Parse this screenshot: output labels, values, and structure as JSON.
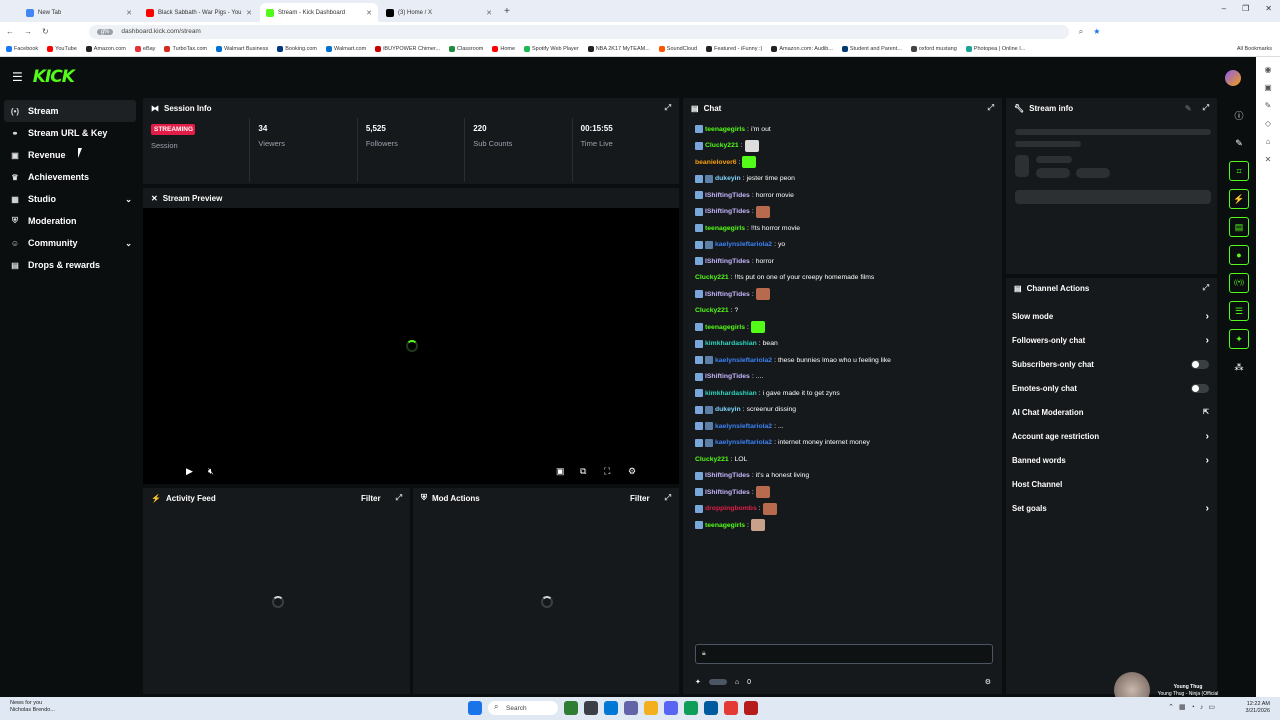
{
  "browser": {
    "tabs": [
      {
        "title": "New Tab",
        "color": "#4285f4",
        "active": false
      },
      {
        "title": "Black Sabbath - War Pigs - You",
        "color": "#ff0000",
        "active": false
      },
      {
        "title": "Stream - Kick Dashboard",
        "color": "#53fc18",
        "active": true
      },
      {
        "title": "(3) Home / X",
        "color": "#000000",
        "active": false
      }
    ],
    "new_tab": "+",
    "url": "dashboard.kick.com/stream",
    "url_chip": "g%",
    "window_controls": [
      "–",
      "❐",
      "✕"
    ],
    "bookmarks": [
      {
        "label": "Facebook",
        "color": "#1877f2"
      },
      {
        "label": "YouTube",
        "color": "#ff0000"
      },
      {
        "label": "Amazon.com",
        "color": "#222222"
      },
      {
        "label": "eBay",
        "color": "#e53238"
      },
      {
        "label": "TurboTax.com",
        "color": "#d52b1e"
      },
      {
        "label": "Walmart Business",
        "color": "#0071ce"
      },
      {
        "label": "Booking.com",
        "color": "#003580"
      },
      {
        "label": "Walmart.com",
        "color": "#0071ce"
      },
      {
        "label": "iBUYPOWER Chimer...",
        "color": "#cc0000"
      },
      {
        "label": "Classroom",
        "color": "#1e8e3e"
      },
      {
        "label": "Home",
        "color": "#ff0000"
      },
      {
        "label": "Spotify Web Player",
        "color": "#1db954"
      },
      {
        "label": "NBA 2K17 MyTEAM...",
        "color": "#222222"
      },
      {
        "label": "SoundCloud",
        "color": "#ff5500"
      },
      {
        "label": "Featured - iFunny :)",
        "color": "#222222"
      },
      {
        "label": "Amazon.com: Audib...",
        "color": "#222222"
      },
      {
        "label": "Student and Parent...",
        "color": "#003a70"
      },
      {
        "label": "oxford mustang",
        "color": "#444444"
      },
      {
        "label": "Photopea | Online I...",
        "color": "#18a497"
      }
    ],
    "all_bookmarks": "All Bookmarks"
  },
  "app": {
    "logo": "KICK",
    "nav": [
      {
        "label": "Stream",
        "icon": "broadcast-icon",
        "glyph": "(•)",
        "active": true,
        "chevron": false
      },
      {
        "label": "Stream URL & Key",
        "icon": "link-icon",
        "glyph": "⚭",
        "active": false,
        "chevron": false
      },
      {
        "label": "Revenue",
        "icon": "wallet-icon",
        "glyph": "▣",
        "active": false,
        "chevron": false
      },
      {
        "label": "Achievements",
        "icon": "trophy-icon",
        "glyph": "♛",
        "active": false,
        "chevron": false
      },
      {
        "label": "Studio",
        "icon": "studio-icon",
        "glyph": "▦",
        "active": false,
        "chevron": true
      },
      {
        "label": "Moderation",
        "icon": "shield-icon",
        "glyph": "⛨",
        "active": false,
        "chevron": false
      },
      {
        "label": "Community",
        "icon": "community-icon",
        "glyph": "☺",
        "active": false,
        "chevron": true
      },
      {
        "label": "Drops & rewards",
        "icon": "gift-icon",
        "glyph": "▤",
        "active": false,
        "chevron": false
      }
    ]
  },
  "session": {
    "title": "Session Info",
    "badge": "STREAMING",
    "badge_sub": "Session",
    "stats": [
      {
        "value": "34",
        "label": "Viewers"
      },
      {
        "value": "5,525",
        "label": "Followers"
      },
      {
        "value": "220",
        "label": "Sub Counts"
      },
      {
        "value": "00:15:55",
        "label": "Time Live"
      }
    ]
  },
  "preview": {
    "title": "Stream Preview"
  },
  "activity": {
    "title": "Activity Feed",
    "filter": "Filter"
  },
  "modactions": {
    "title": "Mod Actions",
    "filter": "Filter"
  },
  "chat": {
    "title": "Chat",
    "messages": [
      {
        "user": "teenagegirls",
        "color": "#53fc18",
        "text": "i'm out",
        "badges": 1,
        "emote": ""
      },
      {
        "user": "Clucky221",
        "color": "#53fc18",
        "text": "",
        "badges": 1,
        "emote": "#dddddd"
      },
      {
        "user": "beanielover6",
        "color": "#f59e0b",
        "text": "",
        "badges": 0,
        "emote": "#53fc18"
      },
      {
        "user": "dukeyin",
        "color": "#7dd3fc",
        "text": "jester time peon",
        "badges": 2,
        "emote": ""
      },
      {
        "user": "IShiftingTides",
        "color": "#c4b5fd",
        "text": "horror movie",
        "badges": 1,
        "emote": ""
      },
      {
        "user": "IShiftingTides",
        "color": "#c4b5fd",
        "text": "",
        "badges": 1,
        "emote": "#b86a4e"
      },
      {
        "user": "teenagegirls",
        "color": "#53fc18",
        "text": "!!ts horror movie",
        "badges": 1,
        "emote": ""
      },
      {
        "user": "kaelynsleftariola2",
        "color": "#3b82f6",
        "text": "yo",
        "badges": 2,
        "emote": ""
      },
      {
        "user": "IShiftingTides",
        "color": "#c4b5fd",
        "text": "horror",
        "badges": 1,
        "emote": ""
      },
      {
        "user": "Clucky221",
        "color": "#53fc18",
        "text": "!!ts put on one of your creepy homemade films",
        "badges": 0,
        "emote": ""
      },
      {
        "user": "IShiftingTides",
        "color": "#c4b5fd",
        "text": "",
        "badges": 1,
        "emote": "#b86a4e"
      },
      {
        "user": "Clucky221",
        "color": "#53fc18",
        "text": "?",
        "badges": 0,
        "emote": ""
      },
      {
        "user": "teenagegirls",
        "color": "#53fc18",
        "text": "",
        "badges": 1,
        "emote": "#53fc18"
      },
      {
        "user": "kimkhardashian",
        "color": "#2dd4bf",
        "text": "bean",
        "badges": 1,
        "emote": ""
      },
      {
        "user": "kaelynsleftariola2",
        "color": "#3b82f6",
        "text": "these bunnies lmao who u feeling like",
        "badges": 2,
        "emote": ""
      },
      {
        "user": "IShiftingTides",
        "color": "#c4b5fd",
        "text": "....",
        "badges": 1,
        "emote": ""
      },
      {
        "user": "kimkhardashian",
        "color": "#2dd4bf",
        "text": "i gave made it to get zyns",
        "badges": 1,
        "emote": ""
      },
      {
        "user": "dukeyin",
        "color": "#7dd3fc",
        "text": "screenur dissing",
        "badges": 2,
        "emote": ""
      },
      {
        "user": "kaelynsleftariola2",
        "color": "#3b82f6",
        "text": "...",
        "badges": 2,
        "emote": ""
      },
      {
        "user": "kaelynsleftariola2",
        "color": "#3b82f6",
        "text": "internet money internet money",
        "badges": 2,
        "emote": ""
      },
      {
        "user": "Clucky221",
        "color": "#53fc18",
        "text": "LOL",
        "badges": 0,
        "emote": ""
      },
      {
        "user": "IShiftingTides",
        "color": "#c4b5fd",
        "text": "it's a honest living",
        "badges": 1,
        "emote": ""
      },
      {
        "user": "IShiftingTides",
        "color": "#c4b5fd",
        "text": "",
        "badges": 1,
        "emote": "#b86a4e"
      },
      {
        "user": "droppingbombs",
        "color": "#e11d48",
        "text": "",
        "badges": 1,
        "emote": "#b86a4e"
      },
      {
        "user": "teenagegirls",
        "color": "#53fc18",
        "text": "",
        "badges": 1,
        "emote": "#c9a08a"
      }
    ],
    "footer_count": "0"
  },
  "streaminfo": {
    "title": "Stream info"
  },
  "channelactions": {
    "title": "Channel Actions",
    "rows": [
      {
        "label": "Slow mode",
        "control": "chevron"
      },
      {
        "label": "Followers-only chat",
        "control": "chevron"
      },
      {
        "label": "Subscribers-only chat",
        "control": "toggle"
      },
      {
        "label": "Emotes-only chat",
        "control": "toggle"
      },
      {
        "label": "AI Chat Moderation",
        "control": "external"
      },
      {
        "label": "Account age restriction",
        "control": "chevron"
      },
      {
        "label": "Banned words",
        "control": "chevron"
      },
      {
        "label": "Host Channel",
        "control": "none"
      },
      {
        "label": "Set goals",
        "control": "chevron"
      }
    ]
  },
  "rail": [
    {
      "name": "info-icon",
      "glyph": "ⓘ",
      "green": false
    },
    {
      "name": "pencil-icon",
      "glyph": "✎",
      "green": false
    },
    {
      "name": "crop-icon",
      "glyph": "⌗",
      "green": true
    },
    {
      "name": "lightning-icon",
      "glyph": "⚡",
      "green": true
    },
    {
      "name": "document-icon",
      "glyph": "▤",
      "green": true
    },
    {
      "name": "chat-bubble-icon",
      "glyph": "●",
      "green": true
    },
    {
      "name": "broadcast-icon",
      "glyph": "((•))",
      "green": true
    },
    {
      "name": "layers-icon",
      "glyph": "☰",
      "green": true
    },
    {
      "name": "wrench-icon",
      "glyph": "✦",
      "green": true
    },
    {
      "name": "nodes-icon",
      "glyph": "⁂",
      "green": false
    }
  ],
  "overlay": {
    "name": "Young Thug",
    "sub": "Young Thug - Ninja (Official Visualizer)"
  },
  "taskbar": {
    "news_title": "News for you",
    "news_sub": "Nicholas Brendo...",
    "search": "Search",
    "time": "12:22 AM",
    "date": "3/21/2026"
  }
}
